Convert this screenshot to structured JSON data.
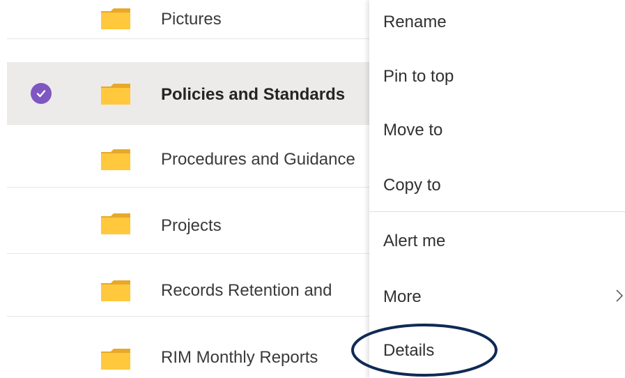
{
  "files": [
    {
      "name": "Pictures",
      "selected": false
    },
    {
      "name": "Policies and Standards",
      "selected": true
    },
    {
      "name": "Procedures and Guidance",
      "selected": false
    },
    {
      "name": "Projects",
      "selected": false
    },
    {
      "name": "Records Retention and",
      "selected": false
    },
    {
      "name": "RIM Monthly Reports",
      "selected": false
    }
  ],
  "context_menu": {
    "items": [
      {
        "label": "Rename"
      },
      {
        "label": "Pin to top"
      },
      {
        "label": "Move to"
      },
      {
        "label": "Copy to"
      },
      {
        "label": "Alert me"
      },
      {
        "label": "More",
        "has_submenu": true
      },
      {
        "label": "Details",
        "highlighted": true
      }
    ]
  },
  "colors": {
    "folder": "#ffc83d",
    "folder_tab": "#e8a82a",
    "selected_row": "#edebe9",
    "check_accent": "#7e57c2",
    "highlight_ring": "#0f2a55"
  }
}
